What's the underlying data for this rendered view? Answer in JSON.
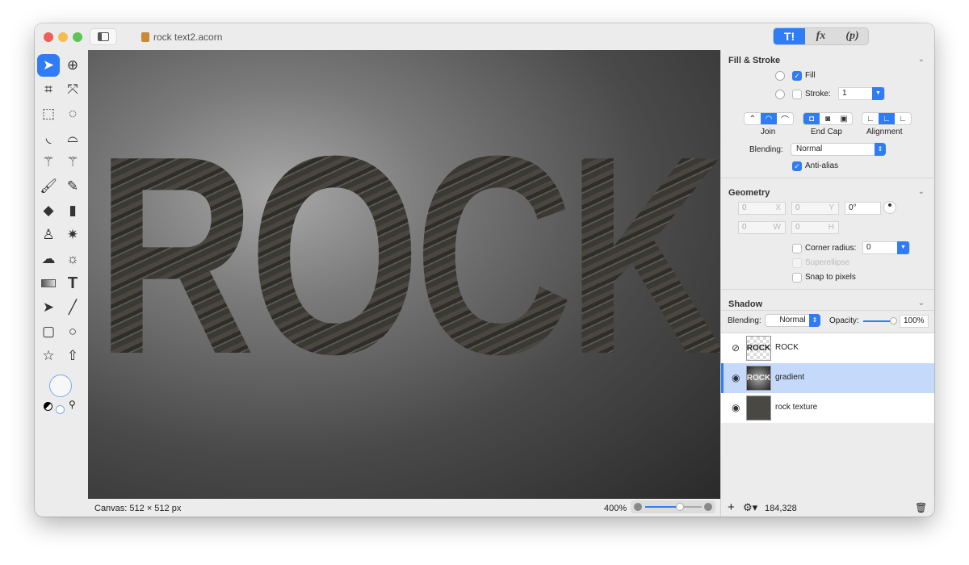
{
  "window": {
    "title": "rock text2.acorn",
    "traffic_lights": {
      "close": "#ed5f57",
      "minimize": "#f5bd4f",
      "zoom": "#5fc454"
    }
  },
  "inspector_tabs": [
    {
      "label": "tools-icon",
      "active": true
    },
    {
      "label": "fx"
    },
    {
      "label": "(p)"
    }
  ],
  "accent": "#2f7cf6",
  "tools": [
    "select-arrow",
    "zoom",
    "crop",
    "transform",
    "rect-select",
    "ellipse-select",
    "lasso",
    "polygon-lasso",
    "magic-wand",
    "color-wand",
    "brush",
    "pencil",
    "paint-bucket",
    "eraser",
    "clone-stamp",
    "smudge",
    "cloud",
    "sun",
    "gradient",
    "text",
    "bezier-pen",
    "line",
    "rectangle",
    "circle",
    "star",
    "arrow"
  ],
  "canvas": {
    "text": "ROCK"
  },
  "status": {
    "canvas_size": "Canvas: 512 × 512 px",
    "zoom": "400%",
    "zoom_slider": 0.6
  },
  "fill_stroke": {
    "title": "Fill & Stroke",
    "fill_label": "Fill",
    "fill_checked": true,
    "stroke_label": "Stroke:",
    "stroke_checked": false,
    "stroke_width": "1",
    "join_label": "Join",
    "endcap_label": "End Cap",
    "alignment_label": "Alignment",
    "blending_label": "Blending:",
    "blending_value": "Normal",
    "antialias_label": "Anti-alias",
    "antialias_checked": true
  },
  "geometry": {
    "title": "Geometry",
    "x": "0",
    "x_suffix": "X",
    "y": "0",
    "y_suffix": "Y",
    "angle": "0°",
    "w": "0",
    "w_suffix": "W",
    "h": "0",
    "h_suffix": "H",
    "corner_radius_label": "Corner radius:",
    "corner_radius": "0",
    "superellipse_label": "Superellipse",
    "snap_label": "Snap to pixels"
  },
  "shadow": {
    "title": "Shadow",
    "blending_label": "Blending:",
    "blending_value": "Normal",
    "opacity_label": "Opacity:",
    "opacity_value": "100%"
  },
  "layers": [
    {
      "name": "ROCK",
      "visible": false,
      "thumb": "ROCK"
    },
    {
      "name": "gradient",
      "visible": true,
      "selected": true,
      "thumb": "ROCK"
    },
    {
      "name": "rock texture",
      "visible": true
    }
  ],
  "layers_footer": {
    "count": "184,328"
  }
}
